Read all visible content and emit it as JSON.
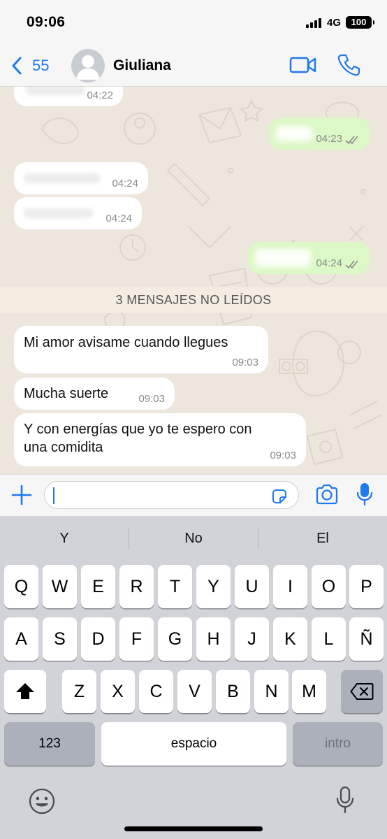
{
  "status_bar": {
    "time": "09:06",
    "network": "4G",
    "battery": "100"
  },
  "header": {
    "back_count": "55",
    "contact_name": "Giuliana"
  },
  "messages": [
    {
      "direction": "in",
      "time": "04:22",
      "text_hidden": true
    },
    {
      "direction": "out",
      "time": "04:23",
      "text_hidden": true,
      "status": "read"
    },
    {
      "direction": "in",
      "time": "04:24",
      "text_hidden": true
    },
    {
      "direction": "in",
      "time": "04:24",
      "text_hidden": true
    },
    {
      "direction": "out",
      "time": "04:24",
      "text_hidden": true,
      "status": "read"
    },
    {
      "direction": "in",
      "time": "09:03",
      "text": "Mi amor avisame cuando llegues"
    },
    {
      "direction": "in",
      "time": "09:03",
      "text": "Mucha suerte"
    },
    {
      "direction": "in",
      "time": "09:03",
      "text_line1": "Y con energías que yo te espero con",
      "text_line2": "una comidita"
    }
  ],
  "unread_divider": "3 MENSAJES NO LEÍDOS",
  "input": {
    "value": "",
    "placeholder": ""
  },
  "keyboard": {
    "suggestions": [
      "Y",
      "No",
      "El"
    ],
    "row1": [
      "Q",
      "W",
      "E",
      "R",
      "T",
      "Y",
      "U",
      "I",
      "O",
      "P"
    ],
    "row2": [
      "A",
      "S",
      "D",
      "F",
      "G",
      "H",
      "J",
      "K",
      "L",
      "Ñ"
    ],
    "row3": [
      "Z",
      "X",
      "C",
      "V",
      "B",
      "N",
      "M"
    ],
    "numbers_label": "123",
    "space_label": "espacio",
    "return_label": "intro"
  },
  "icons": {
    "back": "chevron-left-icon",
    "avatar": "person-icon",
    "video": "video-camera-icon",
    "call": "phone-icon",
    "plus": "plus-icon",
    "sticker": "sticker-icon",
    "camera": "camera-icon",
    "mic": "microphone-icon",
    "shift": "shift-icon",
    "delete": "backspace-icon",
    "emoji": "emoji-icon",
    "dictation": "dictation-mic-icon"
  },
  "colors": {
    "accent": "#1f7aed",
    "outgoing_bubble": "#dcf8c6",
    "incoming_bubble": "#ffffff",
    "chat_background": "#ece6dc",
    "read_ticks": "#8a8a8a"
  }
}
